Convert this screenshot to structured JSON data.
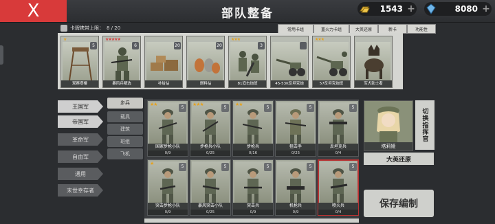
{
  "header": {
    "close_label": "X",
    "title": "部队整备",
    "resources": [
      {
        "icon": "gold-bar-icon",
        "value": "1543"
      },
      {
        "icon": "diamond-icon",
        "value": "8080"
      }
    ]
  },
  "deck": {
    "limit_label": "卡牌携带上限：",
    "limit_value": "8 / 20",
    "filter_tabs": [
      "常用卡组",
      "重火力卡组",
      "大英还原",
      "新卡",
      "功能性"
    ],
    "cards": [
      {
        "name": "观察塔楼",
        "stars": "★",
        "level": "5"
      },
      {
        "name": "暴风兵精选",
        "stars": "★★★★★",
        "level": "6"
      },
      {
        "name": "补给站",
        "stars": "",
        "level": "20"
      },
      {
        "name": "燃料站",
        "stars": "",
        "level": "20"
      },
      {
        "name": "81迫击炮班",
        "stars": "★★★",
        "level": "3"
      },
      {
        "name": "45-53K反坦克炮",
        "stars": "",
        "level": ""
      },
      {
        "name": "57反坦克炮班",
        "stars": "★★★",
        "level": ""
      },
      {
        "name": "军犬助士者",
        "stars": "",
        "level": ""
      }
    ]
  },
  "factions": [
    "王国军",
    "帝国军",
    "革命军",
    "自由军",
    "通用",
    "末世幸存者"
  ],
  "unit_types": [
    "步兵",
    "载具",
    "建筑",
    "班组",
    "飞机"
  ],
  "units": [
    {
      "name": "国家步枪小队",
      "count": "0/9",
      "stars": "★★",
      "level": "5"
    },
    {
      "name": "步枪兵小队",
      "count": "0/25",
      "stars": "★★★",
      "level": "5"
    },
    {
      "name": "步枪兵",
      "count": "0/16",
      "stars": "★★",
      "level": "5"
    },
    {
      "name": "狙击手",
      "count": "0/25",
      "stars": "",
      "level": "5"
    },
    {
      "name": "反坦克兵",
      "count": "0/4",
      "stars": "",
      "level": "5"
    },
    {
      "name": "突击步枪小队",
      "count": "0/9",
      "stars": "★",
      "level": "5"
    },
    {
      "name": "暴风突击小队",
      "count": "0/25",
      "stars": "",
      "level": "5"
    },
    {
      "name": "突击兵",
      "count": "0/9",
      "stars": "",
      "level": "5"
    },
    {
      "name": "机枪兵",
      "count": "0/9",
      "stars": "",
      "level": "5"
    },
    {
      "name": "喷火兵",
      "count": "0/4",
      "stars": "",
      "level": "5"
    }
  ],
  "commander": {
    "name": "塔莉娅",
    "switch_label": "切换指挥官",
    "doctrine": "大英还原"
  },
  "save_label": "保存编制",
  "colors": {
    "close": "#d83a3a",
    "star": "#e5a21f",
    "selected_outline": "#b83333"
  }
}
